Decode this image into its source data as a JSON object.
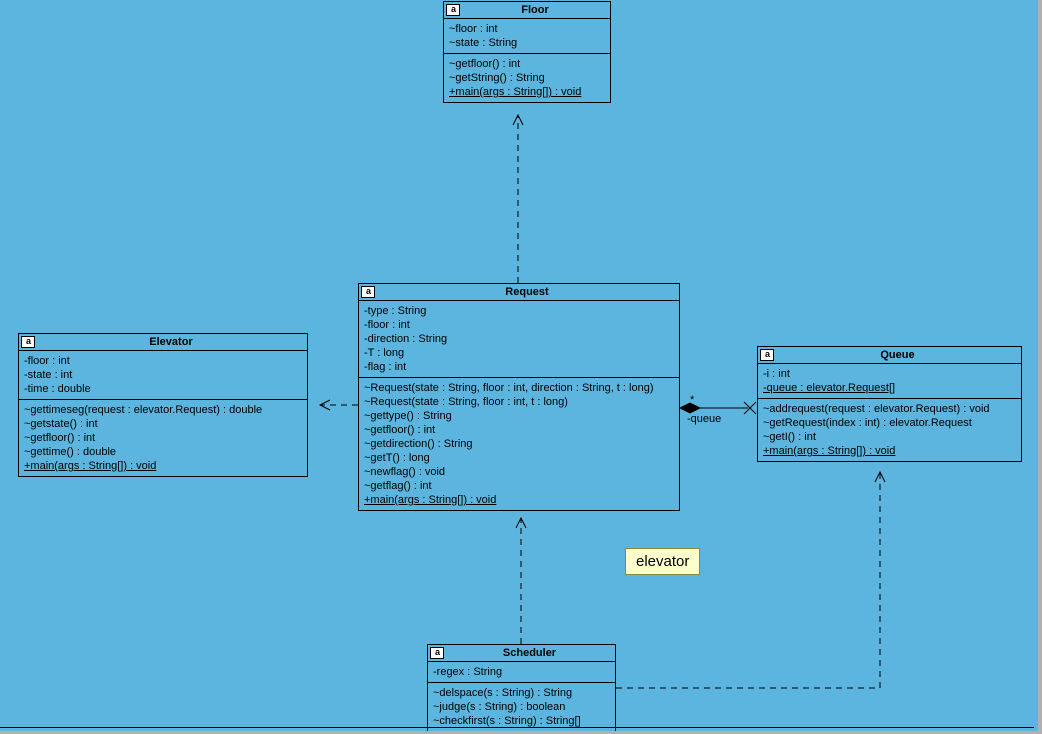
{
  "diagram": {
    "package_label": "elevator",
    "classes": {
      "floor": {
        "name": "Floor",
        "attrs": [
          "~floor : int",
          "~state : String"
        ],
        "ops": [
          "~getfloor() : int",
          "~getString() : String",
          "+main(args : String[]) : void"
        ],
        "ops_underline": [
          false,
          false,
          true
        ]
      },
      "elevator": {
        "name": "Elevator",
        "attrs": [
          "-floor : int",
          "-state : int",
          "-time : double"
        ],
        "ops": [
          "~gettimeseg(request : elevator.Request) : double",
          "~getstate() : int",
          "~getfloor() : int",
          "~gettime() : double",
          "+main(args : String[]) : void"
        ],
        "ops_underline": [
          false,
          false,
          false,
          false,
          true
        ]
      },
      "request": {
        "name": "Request",
        "attrs": [
          "-type : String",
          "-floor : int",
          "-direction : String",
          "-T : long",
          "-flag : int"
        ],
        "ops": [
          "~Request(state : String, floor : int, direction : String, t : long)",
          "~Request(state : String, floor : int, t : long)",
          "~gettype() : String",
          "~getfloor() : int",
          "~getdirection() : String",
          "~getT() : long",
          "~newflag() : void",
          "~getflag() : int",
          "+main(args : String[]) : void"
        ],
        "ops_underline": [
          false,
          false,
          false,
          false,
          false,
          false,
          false,
          false,
          true
        ]
      },
      "queue": {
        "name": "Queue",
        "attrs": [
          "-i : int",
          "-queue : elevator.Request[]"
        ],
        "attrs_underline": [
          false,
          true
        ],
        "ops": [
          "~addrequest(request : elevator.Request) : void",
          "~getRequest(index : int) : elevator.Request",
          "~getI() : int",
          "+main(args : String[]) : void"
        ],
        "ops_underline": [
          false,
          false,
          false,
          true
        ]
      },
      "scheduler": {
        "name": "Scheduler",
        "attrs": [
          "-regex : String"
        ],
        "ops": [
          "~delspace(s : String) : String",
          "~judge(s : String) : boolean",
          "~checkfirst(s : String) : String[]"
        ]
      }
    },
    "assoc": {
      "queue_role": "-queue",
      "queue_mult": "*"
    }
  }
}
